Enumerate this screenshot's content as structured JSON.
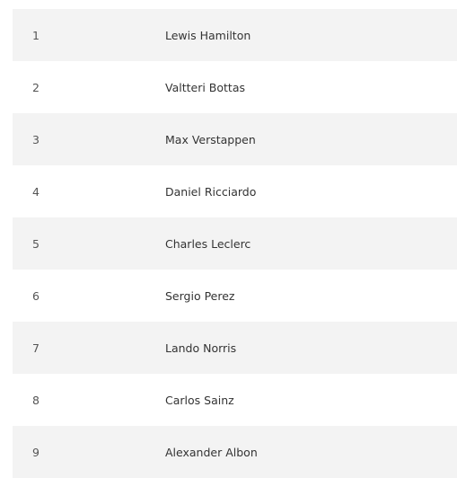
{
  "standings": [
    {
      "position": "1",
      "driver": "Lewis Hamilton"
    },
    {
      "position": "2",
      "driver": "Valtteri Bottas"
    },
    {
      "position": "3",
      "driver": "Max Verstappen"
    },
    {
      "position": "4",
      "driver": "Daniel Ricciardo"
    },
    {
      "position": "5",
      "driver": "Charles Leclerc"
    },
    {
      "position": "6",
      "driver": "Sergio Perez"
    },
    {
      "position": "7",
      "driver": "Lando Norris"
    },
    {
      "position": "8",
      "driver": "Carlos Sainz"
    },
    {
      "position": "9",
      "driver": "Alexander Albon"
    }
  ]
}
